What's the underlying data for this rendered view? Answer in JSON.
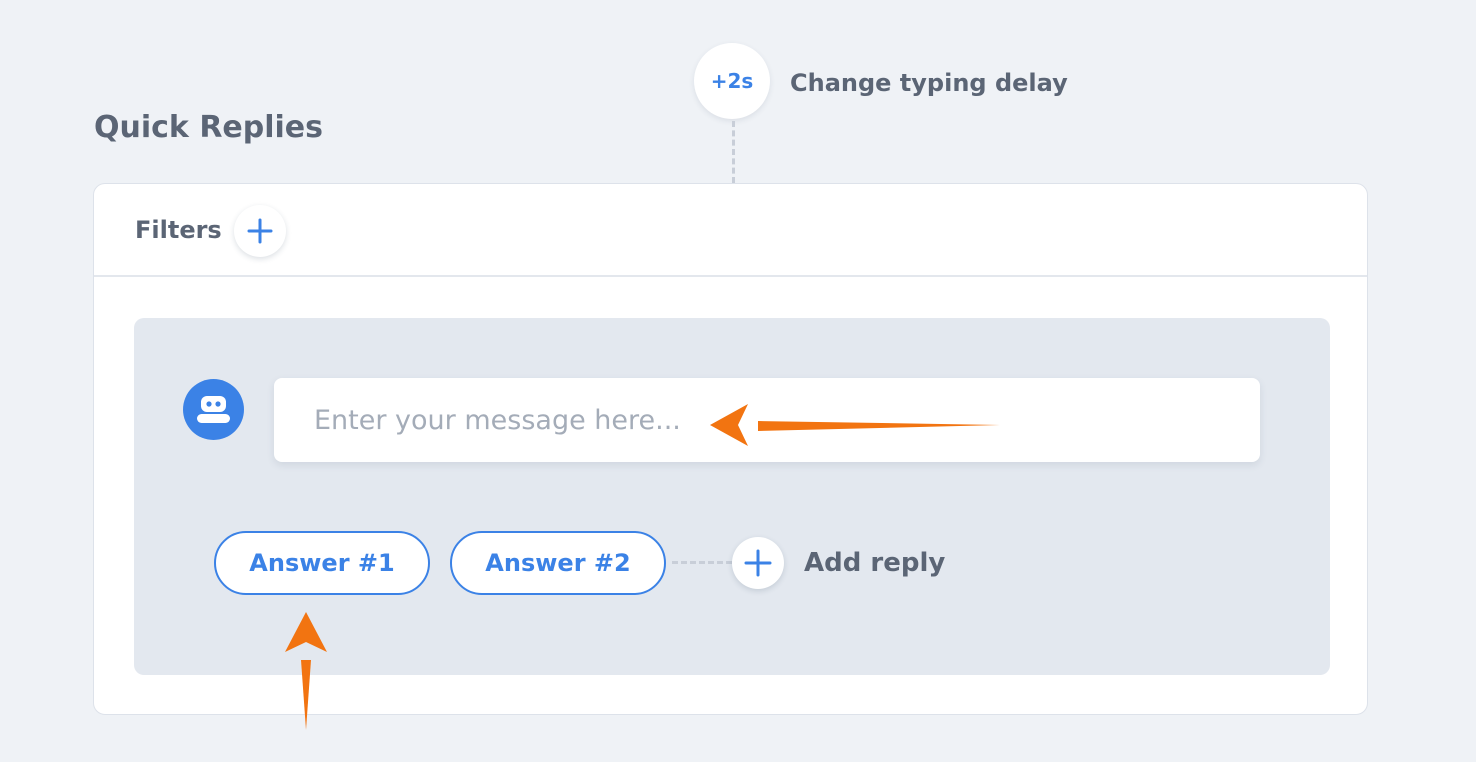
{
  "typing_delay": {
    "badge_label": "+2s",
    "label": "Change typing delay"
  },
  "section_title": "Quick Replies",
  "filters": {
    "label": "Filters",
    "add_icon": "plus-icon"
  },
  "message": {
    "avatar_icon": "robot-icon",
    "value": "",
    "placeholder": "Enter your message here..."
  },
  "replies": [
    {
      "label": "Answer #1"
    },
    {
      "label": "Answer #2"
    }
  ],
  "add_reply": {
    "label": "Add reply",
    "icon": "plus-icon"
  },
  "colors": {
    "accent": "#3b82e6",
    "annotation_arrow": "#f27411",
    "background": "#eff2f6",
    "message_area": "#e3e8ef"
  }
}
